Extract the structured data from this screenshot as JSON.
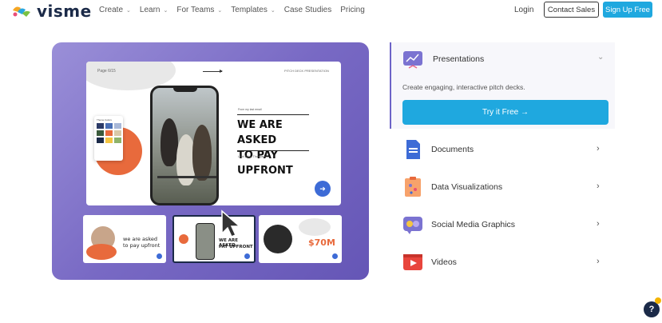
{
  "nav": {
    "logo_text": "visme",
    "menu": [
      {
        "label": "Create",
        "has_dropdown": true
      },
      {
        "label": "Learn",
        "has_dropdown": true
      },
      {
        "label": "For Teams",
        "has_dropdown": true
      },
      {
        "label": "Templates",
        "has_dropdown": true
      },
      {
        "label": "Case Studies",
        "has_dropdown": false
      },
      {
        "label": "Pricing",
        "has_dropdown": false
      }
    ],
    "login": "Login",
    "contact_sales": "Contact Sales",
    "signup": "Sign Up Free"
  },
  "hero": {
    "slide": {
      "page_label": "Page 6/15",
      "tag": "PITCH DECK PRESENTATION",
      "palette_title": "Theme Colors",
      "small_text": "From my last email",
      "heading_line1": "WE ARE ASKED",
      "heading_line2": "TO PAY UPFRONT",
      "author": "Leah Baker Thompson"
    },
    "thumbs": [
      {
        "text_line1": "we are asked",
        "text_line2": "to pay upfront"
      },
      {
        "text_line1": "WE ARE ASKED",
        "text_line2": "PAY UPFRONT"
      },
      {
        "text_value": "$70M"
      }
    ]
  },
  "panel": {
    "active": {
      "label": "Presentations",
      "description": "Create engaging, interactive pitch decks.",
      "button": "Try it Free →"
    },
    "items": [
      {
        "label": "Documents",
        "icon": "document-icon"
      },
      {
        "label": "Data Visualizations",
        "icon": "data-visualization-icon"
      },
      {
        "label": "Social Media Graphics",
        "icon": "social-media-icon"
      },
      {
        "label": "Videos",
        "icon": "video-icon"
      }
    ]
  },
  "help": {
    "label": "?"
  },
  "colors": {
    "accent": "#1fa8df",
    "brand_dark": "#1b2a48",
    "hero_purple": "#7869c4"
  }
}
